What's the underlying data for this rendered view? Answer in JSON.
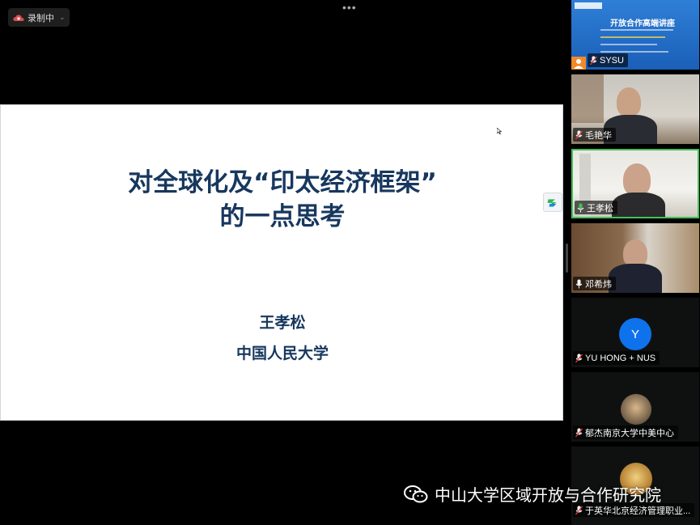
{
  "recording": {
    "label": "录制中",
    "chevron": "⌄",
    "icon": "cloud-record-icon"
  },
  "toolbar": {
    "more_icon": "more-dots-icon"
  },
  "slide": {
    "title_line1": "对全球化及“印太经济框架”",
    "title_line2": "的一点思考",
    "author": "王孝松",
    "affiliation": "中国人民大学",
    "title_color": "#17375e"
  },
  "participants": [
    {
      "name": "SYSU",
      "type": "banner",
      "banner_title": "开放合作高端讲座"
    },
    {
      "name": "毛艳华",
      "type": "video"
    },
    {
      "name": "王孝松",
      "type": "video",
      "active_speaker": true
    },
    {
      "name": "邓希炜",
      "type": "video"
    },
    {
      "name": "YU HONG + NUS",
      "type": "avatar",
      "initial": "Y"
    },
    {
      "name": "郁杰南京大学中美中心",
      "type": "photo"
    },
    {
      "name": "于英华北京经济管理职业...",
      "type": "photo"
    }
  ],
  "watermark": {
    "text": "中山大学区域开放与合作研究院",
    "icon": "wechat-icon"
  },
  "colors": {
    "accent": "#0e72ed",
    "active_border": "#43c15a",
    "mic_muted": "#e0383b"
  }
}
